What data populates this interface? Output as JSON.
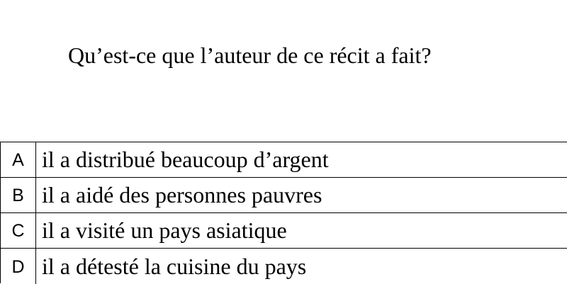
{
  "question": "Qu’est-ce que l’auteur de ce récit a fait?",
  "options": [
    {
      "letter": "A",
      "text": "il a distribué beaucoup d’argent"
    },
    {
      "letter": "B",
      "text": "il a aidé des personnes pauvres"
    },
    {
      "letter": "C",
      "text": "il a visité un pays asiatique"
    },
    {
      "letter": "D",
      "text": "il a détesté la cuisine du pays"
    }
  ]
}
